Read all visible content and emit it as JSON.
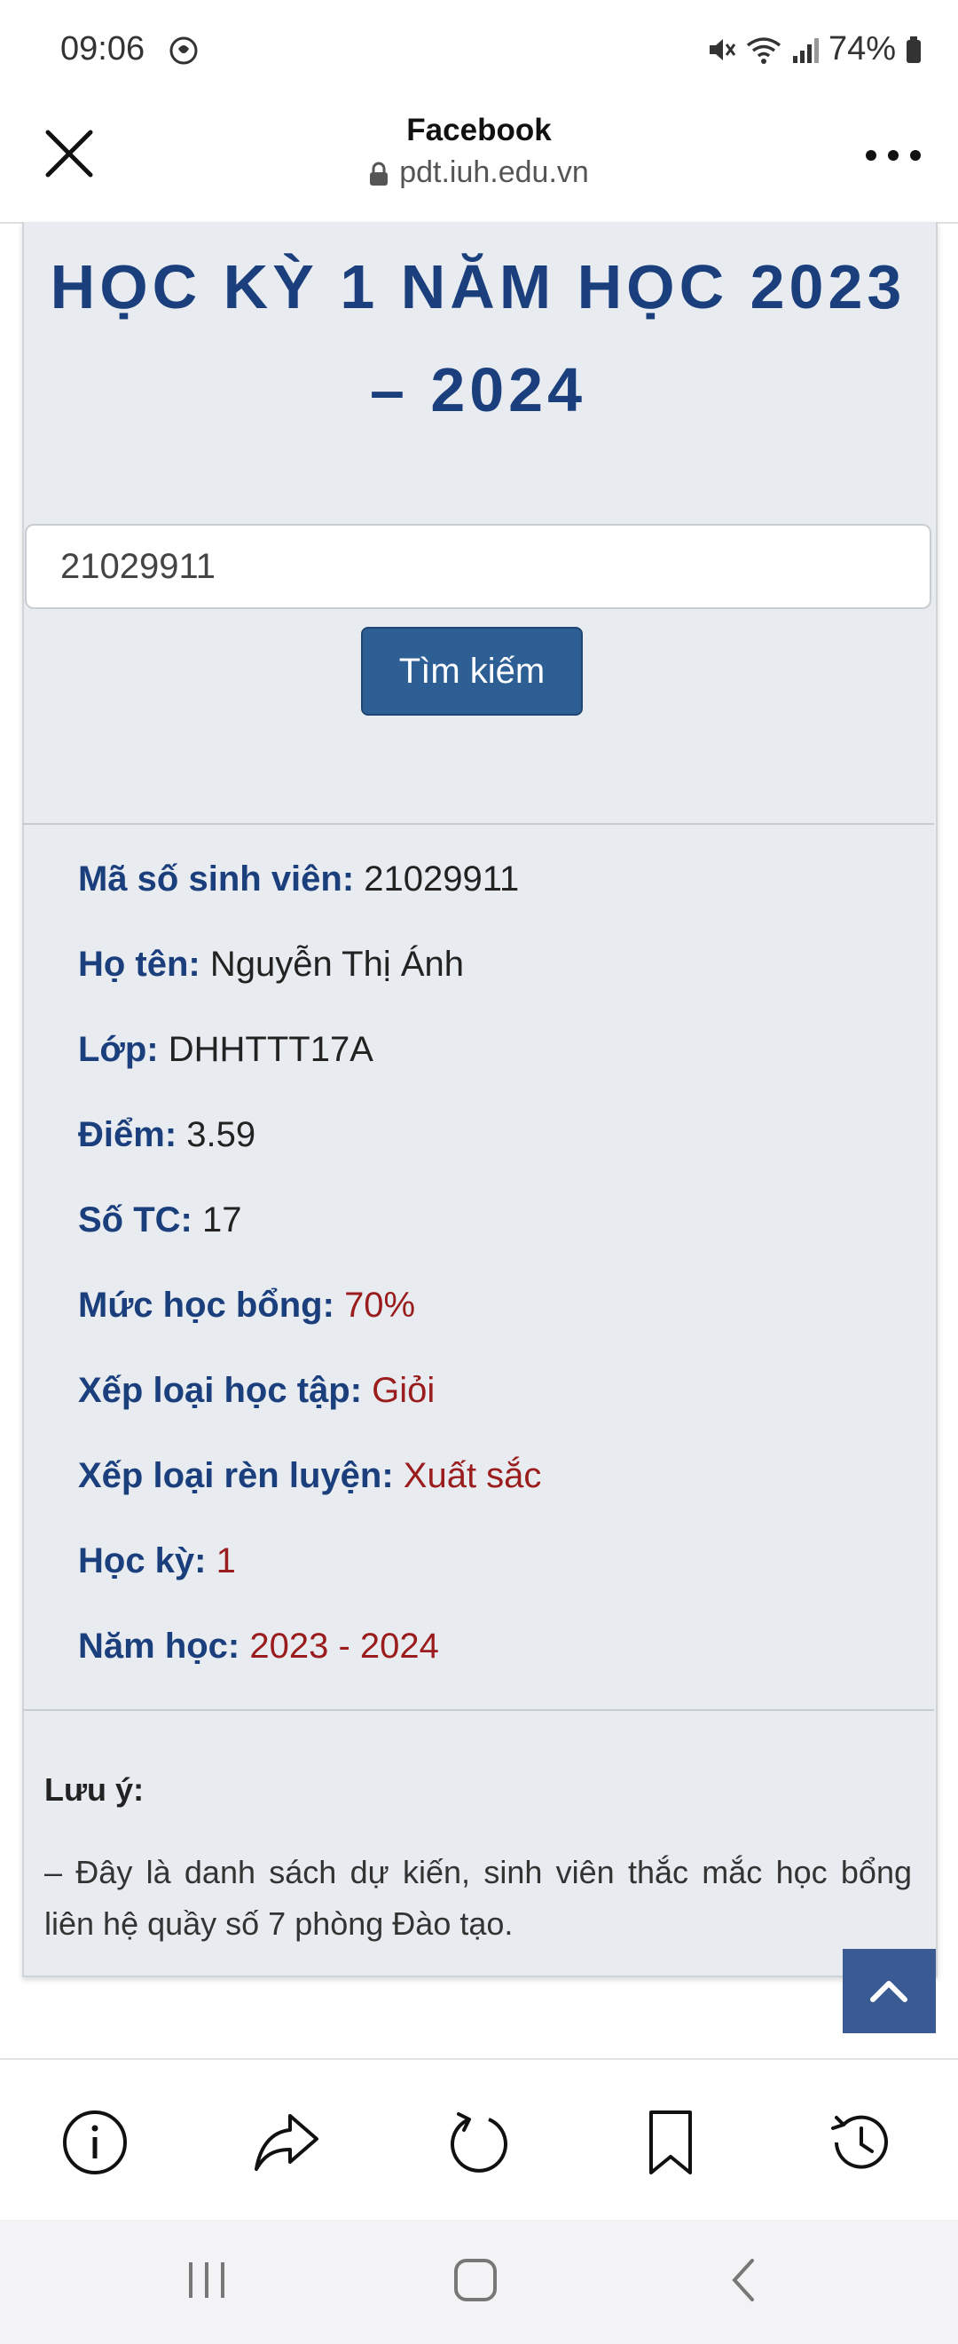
{
  "status_bar": {
    "time": "09:06",
    "battery": "74%"
  },
  "browser": {
    "title": "Facebook",
    "url": "pdt.iuh.edu.vn"
  },
  "page": {
    "heading": "HỌC KỲ 1 NĂM HỌC 2023 – 2024",
    "search": {
      "value": "21029911",
      "button": "Tìm kiếm"
    },
    "info": [
      {
        "label": "Mã số sinh viên:",
        "value": "21029911"
      },
      {
        "label": "Họ tên:",
        "value": "Nguyễn Thị Ánh"
      },
      {
        "label": "Lớp:",
        "value": "DHHTTT17A"
      },
      {
        "label": "Điểm:",
        "value": "3.59"
      },
      {
        "label": "Số TC:",
        "value": "17"
      },
      {
        "label": "Mức học bổng:",
        "value": "70%"
      },
      {
        "label": "Xếp loại học tập:",
        "value": "Giỏi"
      },
      {
        "label": "Xếp loại rèn luyện:",
        "value": "Xuất sắc"
      },
      {
        "label": "Học kỳ:",
        "value": "1"
      },
      {
        "label": "Năm học:",
        "value": "2023 - 2024"
      }
    ],
    "note": {
      "title": "Lưu ý:",
      "text": "– Đây là danh sách dự kiến, sinh viên thắc mắc học bổng liên hệ quầy số 7 phòng Đào tạo."
    }
  },
  "colors": {
    "heading": "#1b3f7c",
    "button": "#2d5e94",
    "highlight": "#9b1c1c"
  },
  "icons": {
    "toolbar": [
      "info-icon",
      "share-icon",
      "reload-icon",
      "bookmark-icon",
      "history-icon"
    ],
    "nav": [
      "recent-apps-icon",
      "home-icon",
      "back-icon"
    ]
  }
}
